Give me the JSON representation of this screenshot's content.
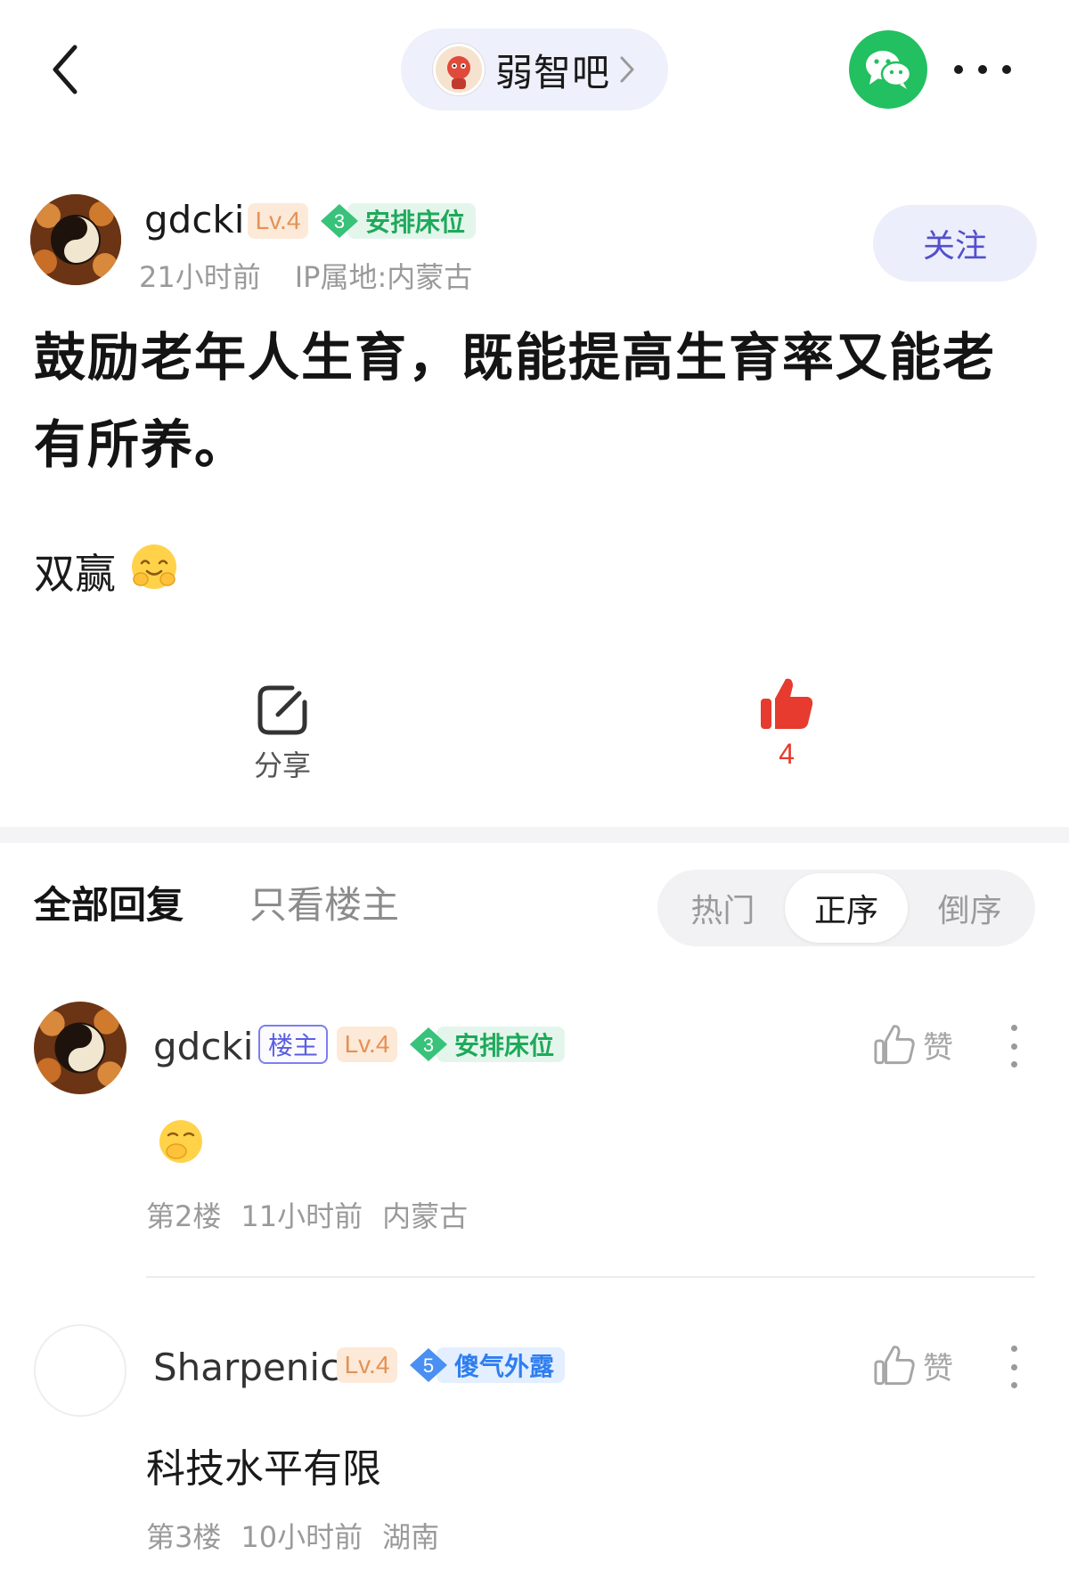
{
  "header": {
    "forum_name": "弱智吧"
  },
  "post": {
    "author": {
      "name": "gdcki",
      "level": "Lv.4",
      "title_level": "3",
      "title": "安排床位"
    },
    "time": "21小时前",
    "ip_location": "IP属地:内蒙古",
    "follow_label": "关注",
    "title": "鼓励老年人生育，既能提高生育率又能老有所养。",
    "body": "双赢",
    "share_label": "分享",
    "like_count": "4"
  },
  "replies": {
    "tab_all": "全部回复",
    "tab_op_only": "只看楼主",
    "sort_options": [
      "热门",
      "正序",
      "倒序"
    ],
    "sort_selected": "正序",
    "items": [
      {
        "name": "gdcki",
        "op_badge": "楼主",
        "level": "Lv.4",
        "title_level": "3",
        "title": "安排床位",
        "like_label": "赞",
        "floor": "第2楼",
        "time": "11小时前",
        "location": "内蒙古"
      },
      {
        "name": "Sharpenic",
        "level": "Lv.4",
        "title_level": "5",
        "title": "傻气外露",
        "like_label": "赞",
        "text": "科技水平有限",
        "floor": "第3楼",
        "time": "10小时前",
        "location": "湖南"
      }
    ]
  },
  "colors": {
    "accent_purple": "#5250cd",
    "like_red": "#e63b2e",
    "wechat_green": "#22c060",
    "badge_green": "#1fa95b",
    "badge_blue": "#2f7ef0",
    "level_orange": "#e39256"
  },
  "icons": [
    "back-chevron-icon",
    "wechat-icon",
    "more-icon",
    "share-icon",
    "thumbs-up-filled-icon",
    "thumbs-up-outline-icon",
    "smile-emoji-icon",
    "giggle-emoji-icon"
  ]
}
